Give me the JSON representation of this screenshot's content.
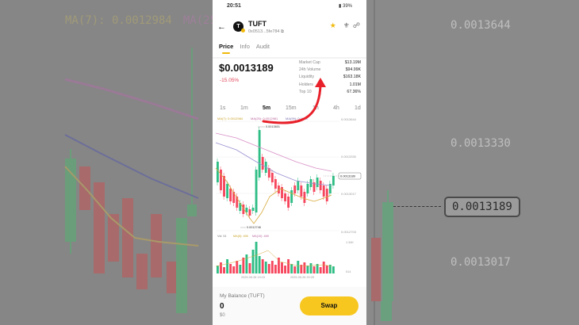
{
  "background": {
    "left_ma7": "MA(7): 0.0012984",
    "left_ma25": "MA(25",
    "right_labels": [
      "0.0013644",
      "0.0013330",
      "0.0013017"
    ],
    "right_current": "0.0013189"
  },
  "status": {
    "time": "20:51",
    "battery": "39%"
  },
  "header": {
    "token": "TUFT",
    "address": "0x0513...5fe784",
    "logo_letter": "T"
  },
  "tabs": [
    "Price",
    "Info",
    "Audit"
  ],
  "price": {
    "value": "$0.0013189",
    "change": "-15.05%"
  },
  "stats": [
    {
      "label": "Market Cap",
      "value": "$13.19M"
    },
    {
      "label": "24h Volume",
      "value": "$94.99K"
    },
    {
      "label": "Liquidity",
      "value": "$163.18K"
    },
    {
      "label": "Holders",
      "value": "1.01M"
    },
    {
      "label": "Top 10",
      "value": "67.36%"
    }
  ],
  "intervals": [
    "1s",
    "1m",
    "5m",
    "15m",
    "1h",
    "4h",
    "1d"
  ],
  "active_interval": "5m",
  "chart": {
    "ma7_label": "MA(7): 0.0012984",
    "ma25_label": "MA(25): 0.0012981",
    "ma99_label": "MA(99): 0.0013",
    "high_label": "0.0013601",
    "low_label": "0.0012746",
    "y_labels": [
      "0.0013644",
      "0.0013330",
      "0.0013017",
      "0.0012703"
    ],
    "current_price": "0.0013189",
    "vol_label": "Vol: 51",
    "vol_ma5": "MA(5): 496",
    "vol_ma10": "MA(10): 469",
    "vol_y": [
      "1.34K",
      "514"
    ],
    "x_dates": [
      "2025-05-26 19:15",
      "2025-05-26 20:25"
    ]
  },
  "balance": {
    "label": "My Balance (TUFT)",
    "amount": "0",
    "usd": "$0",
    "swap_label": "Swap"
  },
  "colors": {
    "up": "#2ebd85",
    "down": "#f6465d",
    "accent": "#f0b90b",
    "arrow": "#e8202a"
  }
}
